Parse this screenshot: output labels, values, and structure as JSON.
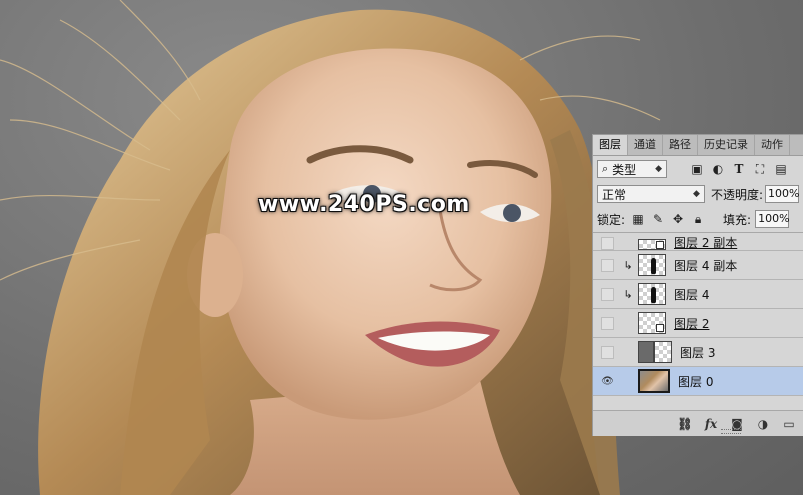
{
  "watermark": "www.240PS.com",
  "panel": {
    "tabs": [
      "图层",
      "通道",
      "路径",
      "历史记录",
      "动作"
    ],
    "active_tab": 0,
    "filter": {
      "label": "类型",
      "search_symbol": "⌕"
    },
    "blend_mode": "正常",
    "opacity_label": "不透明度:",
    "opacity_value": "100%",
    "lock_label": "锁定:",
    "fill_label": "填充:",
    "fill_value": "100%",
    "layers": [
      {
        "name": "图层 2 副本",
        "visible": false,
        "clipped": false,
        "thumb": "transparent-smart",
        "partial": true,
        "underline": true
      },
      {
        "name": "图层 4 副本",
        "visible": false,
        "clipped": true,
        "thumb": "transparent-black",
        "partial": false,
        "underline": false
      },
      {
        "name": "图层 4",
        "visible": false,
        "clipped": true,
        "thumb": "transparent-black",
        "partial": false,
        "underline": false
      },
      {
        "name": "图层 2",
        "visible": false,
        "clipped": false,
        "thumb": "transparent-smart",
        "partial": false,
        "underline": true
      },
      {
        "name": "图层 3",
        "visible": false,
        "clipped": false,
        "thumb": "gray-mask",
        "partial": false,
        "underline": false
      },
      {
        "name": "图层 0",
        "visible": true,
        "clipped": false,
        "thumb": "photo",
        "partial": false,
        "underline": false,
        "selected": true
      }
    ],
    "icons": {
      "filter": [
        "image-icon",
        "adjustment-icon",
        "type-icon",
        "shape-icon",
        "smart-object-icon"
      ],
      "lock": [
        "lock-pixels-icon",
        "lock-paint-icon",
        "lock-move-icon",
        "lock-all-icon"
      ],
      "bottom": [
        "link-icon",
        "fx-icon",
        "mask-icon",
        "adjustment-layer-icon",
        "folder-icon"
      ]
    }
  },
  "colors": {
    "panel_bg": "#d6d6d6",
    "selected_layer": "#b7cbe9",
    "canvas_bg": "#7a7a7a"
  }
}
